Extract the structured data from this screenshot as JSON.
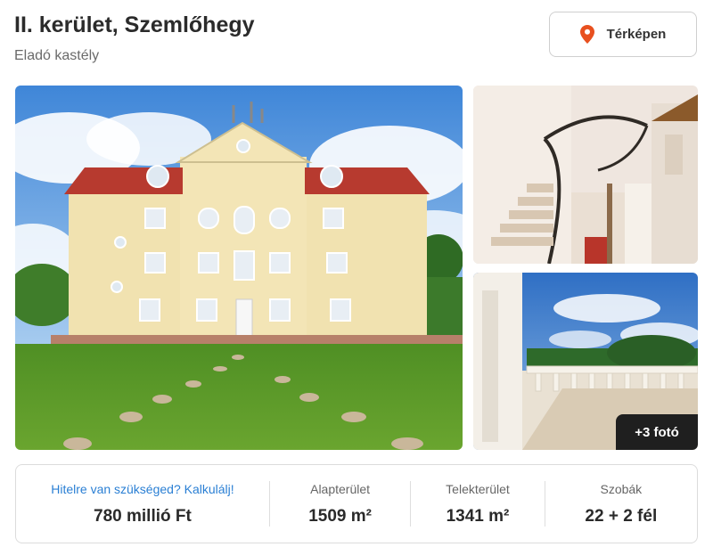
{
  "listing": {
    "title": "II. kerület, Szemlőhegy",
    "subtitle": "Eladó kastély"
  },
  "map_button": {
    "label": "Térképen",
    "icon": "map-pin-icon",
    "icon_color": "#e8501f"
  },
  "gallery": {
    "more_photos_label": "+3 fotó"
  },
  "details": {
    "price_label": "Hitelre van szükséged? Kalkulálj!",
    "price_value": "780 millió Ft",
    "floor_area_label": "Alapterület",
    "floor_area_value": "1509 m²",
    "plot_area_label": "Telekterület",
    "plot_area_value": "1341 m²",
    "rooms_label": "Szobák",
    "rooms_value": "22 + 2 fél"
  },
  "colors": {
    "link_blue": "#2a7fd4",
    "pin_orange": "#e8501f"
  }
}
